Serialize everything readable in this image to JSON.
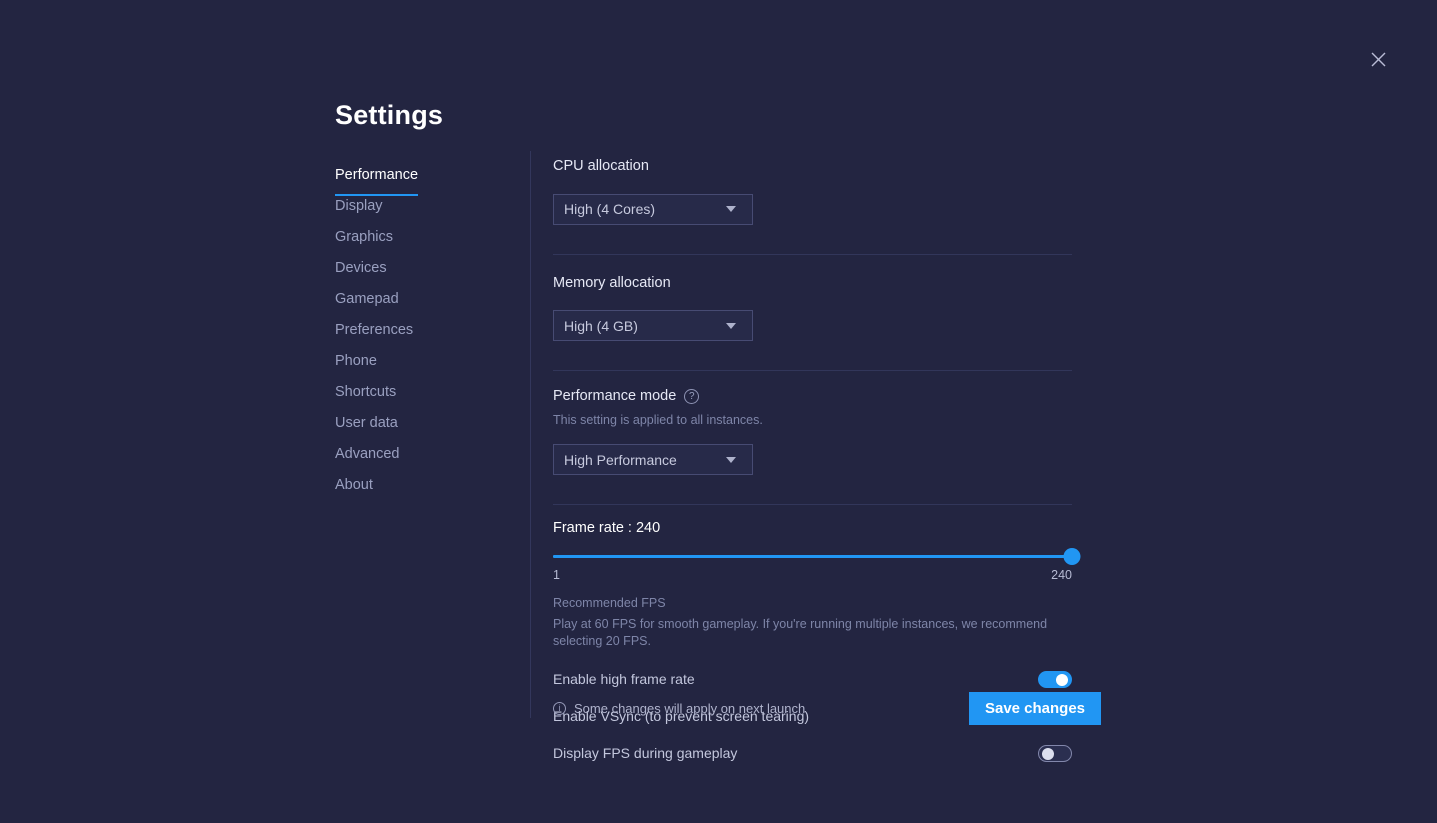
{
  "window": {
    "title": "Settings",
    "close_icon": "close-icon",
    "background_color": "#232541",
    "accent_color": "#2196f3"
  },
  "sidebar": {
    "items": [
      {
        "label": "Performance",
        "active": true
      },
      {
        "label": "Display",
        "active": false
      },
      {
        "label": "Graphics",
        "active": false
      },
      {
        "label": "Devices",
        "active": false
      },
      {
        "label": "Gamepad",
        "active": false
      },
      {
        "label": "Preferences",
        "active": false
      },
      {
        "label": "Phone",
        "active": false
      },
      {
        "label": "Shortcuts",
        "active": false
      },
      {
        "label": "User data",
        "active": false
      },
      {
        "label": "Advanced",
        "active": false
      },
      {
        "label": "About",
        "active": false
      }
    ]
  },
  "cpu_allocation": {
    "label": "CPU allocation",
    "value": "High (4 Cores)"
  },
  "memory_allocation": {
    "label": "Memory allocation",
    "value": "High (4 GB)"
  },
  "performance_mode": {
    "label": "Performance mode",
    "help_icon": "question-mark-icon",
    "description": "This setting is applied to all instances.",
    "value": "High Performance"
  },
  "frame_rate": {
    "label": "Frame rate : 240",
    "value": 240,
    "min": 1,
    "max": 240,
    "min_label": "1",
    "max_label": "240",
    "recommended_title": "Recommended FPS",
    "recommended_body": "Play at 60 FPS for smooth gameplay. If you're running multiple instances, we recommend selecting 20 FPS."
  },
  "toggles": [
    {
      "label": "Enable high frame rate",
      "on": true
    },
    {
      "label": "Enable VSync (to prevent screen tearing)",
      "on": false
    },
    {
      "label": "Display FPS during gameplay",
      "on": false
    }
  ],
  "footer": {
    "info_icon": "info-icon",
    "note": "Some changes will apply on next launch",
    "save_label": "Save changes"
  }
}
